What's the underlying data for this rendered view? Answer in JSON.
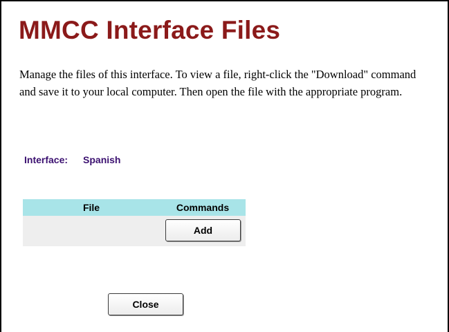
{
  "page": {
    "title": "MMCC Interface Files",
    "intro": "Manage the files of this interface.  To view a file, right-click the \"Download\" command and save it to your local computer.  Then open the file with the appropriate program."
  },
  "interface": {
    "label": "Interface:",
    "value": "Spanish"
  },
  "files_table": {
    "columns": [
      "File",
      "Commands"
    ],
    "rows": [
      {
        "file": "",
        "command": "Add"
      }
    ]
  },
  "actions": {
    "close_label": "Close"
  },
  "colors": {
    "title": "#8b1a1a",
    "interface_text": "#3b1070",
    "table_header": "#a8e4e8",
    "table_row": "#eeeeee"
  }
}
